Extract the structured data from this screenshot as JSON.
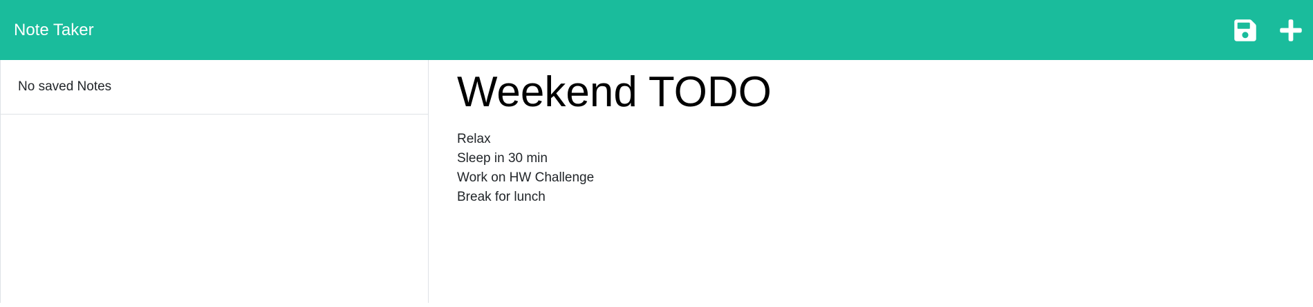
{
  "app": {
    "title": "Note Taker"
  },
  "toolbar": {
    "save_icon": "save-icon",
    "new_icon": "plus-icon",
    "accent_color": "#1abc9c"
  },
  "sidebar": {
    "empty_message": "No saved Notes"
  },
  "note": {
    "title": "Weekend TODO",
    "lines": [
      "Relax",
      "Sleep in 30 min",
      "Work on HW Challenge",
      "Break for lunch"
    ]
  }
}
